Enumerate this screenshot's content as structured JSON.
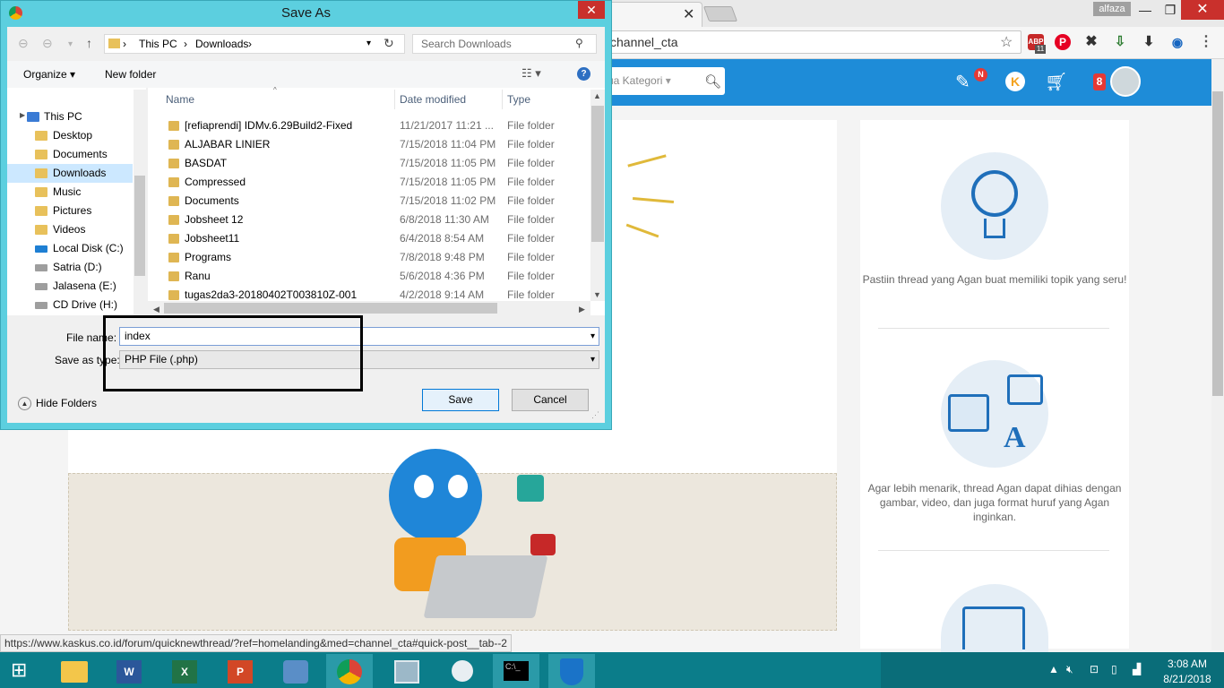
{
  "browser": {
    "profile": "alfaza",
    "url_fragment": "channel_cta",
    "status_url": "https://www.kaskus.co.id/forum/quicknewthread/?ref=homelanding&med=channel_cta#quick-post__tab--2",
    "ext_badge": "11"
  },
  "kaskus": {
    "category_label": "ua Kategori",
    "notif_badge": "N",
    "cart_badge": "8",
    "tips": [
      "Pastiin thread yang Agan buat memiliki topik yang seru!",
      "Agar lebih menarik, thread Agan dapat dihias dengan gambar, video, dan juga format huruf yang Agan inginkan."
    ]
  },
  "dialog": {
    "title": "Save As",
    "address": {
      "this_pc": "This PC",
      "separator": "›",
      "downloads": "Downloads"
    },
    "search_placeholder": "Search Downloads",
    "organize_label": "Organize",
    "new_folder_label": "New folder",
    "nav_items": [
      {
        "label": "This PC"
      },
      {
        "label": "Desktop"
      },
      {
        "label": "Documents"
      },
      {
        "label": "Downloads"
      },
      {
        "label": "Music"
      },
      {
        "label": "Pictures"
      },
      {
        "label": "Videos"
      },
      {
        "label": "Local Disk (C:)"
      },
      {
        "label": "Satria (D:)"
      },
      {
        "label": "Jalasena (E:)"
      },
      {
        "label": "CD Drive (H:)"
      }
    ],
    "columns": {
      "name": "Name",
      "date": "Date modified",
      "type": "Type"
    },
    "files": [
      {
        "name": "[refiaprendi] IDMv.6.29Build2-Fixed",
        "date": "11/21/2017 11:21 ...",
        "type": "File folder"
      },
      {
        "name": "ALJABAR LINIER",
        "date": "7/15/2018 11:04 PM",
        "type": "File folder"
      },
      {
        "name": "BASDAT",
        "date": "7/15/2018 11:05 PM",
        "type": "File folder"
      },
      {
        "name": "Compressed",
        "date": "7/15/2018 11:05 PM",
        "type": "File folder"
      },
      {
        "name": "Documents",
        "date": "7/15/2018 11:02 PM",
        "type": "File folder"
      },
      {
        "name": "Jobsheet 12",
        "date": "6/8/2018 11:30 AM",
        "type": "File folder"
      },
      {
        "name": "Jobsheet11",
        "date": "6/4/2018 8:54 AM",
        "type": "File folder"
      },
      {
        "name": "Programs",
        "date": "7/8/2018 9:48 PM",
        "type": "File folder"
      },
      {
        "name": "Ranu",
        "date": "5/6/2018 4:36 PM",
        "type": "File folder"
      },
      {
        "name": "tugas2da3-20180402T003810Z-001",
        "date": "4/2/2018 9:14 AM",
        "type": "File folder"
      }
    ],
    "file_name_label": "File name:",
    "file_name_value": "index",
    "save_type_label": "Save as type:",
    "save_type_value": "PHP File (.php)",
    "hide_folders_label": "Hide Folders",
    "save_label": "Save",
    "cancel_label": "Cancel"
  },
  "taskbar": {
    "time": "3:08 AM",
    "date": "8/21/2018"
  }
}
